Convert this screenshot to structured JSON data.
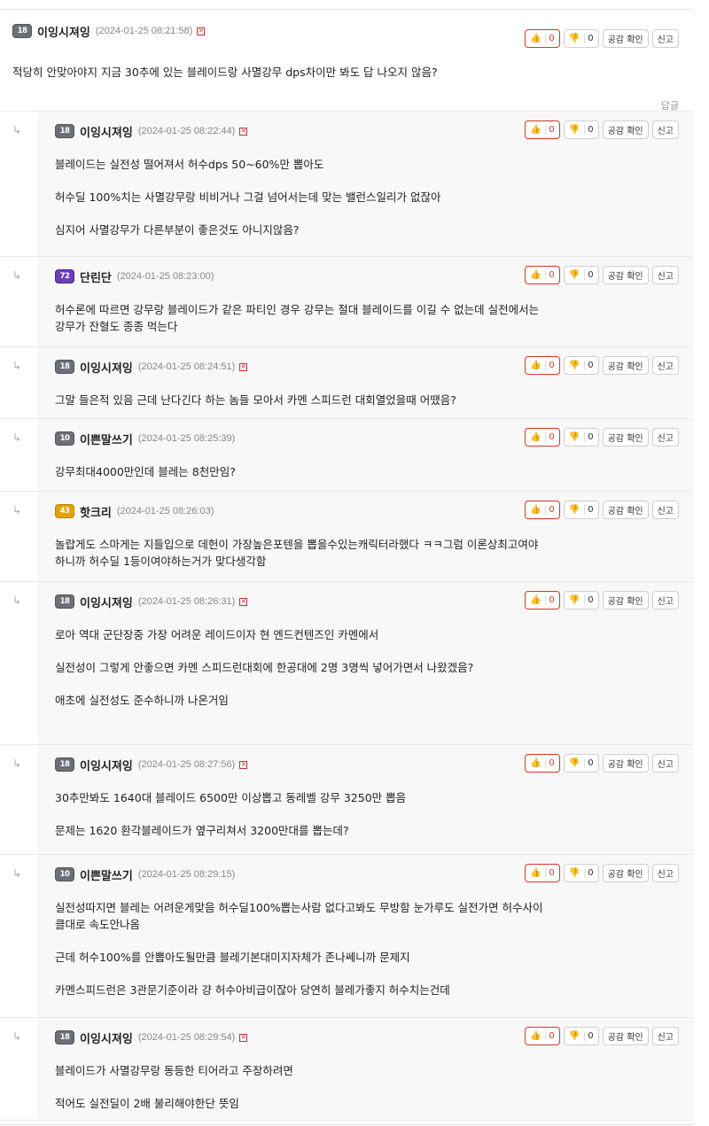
{
  "buttons": {
    "like_icon": "thumbs-up-icon",
    "dislike_icon": "thumbs-down-icon",
    "empathy_label": "공감 확인",
    "report_label": "신고"
  },
  "main_comment": {
    "badge": "18",
    "nick": "이잉시져잉",
    "date": "(2024-01-25 08:21:58)",
    "like": "0",
    "dislike": "0",
    "text": "적당히 안맞아야지 지금 30추에 있는 블레이드랑 사멸강무 dps차이만 봐도 답 나오지 않음?",
    "reply_label": "답글"
  },
  "replies": [
    {
      "badge": "18",
      "nick": "이잉시져잉",
      "date": "(2024-01-25 08:22:44)",
      "like": "0",
      "dislike": "0",
      "paragraphs": [
        "블레이드는 실전성 떨어져서 허수dps 50~60%만 뽑아도",
        "허수딜 100%치는 사멸강무랑 비비거나 그걸 넘어서는데 맞는 밸런스일리가 없잖아",
        "심지어 사멸강무가 다른부분이 좋은것도 아니지않음?"
      ]
    },
    {
      "badge": "72",
      "nick": "단린단",
      "date": "(2024-01-25 08:23:00)",
      "like": "0",
      "dislike": "0",
      "paragraphs": [
        "허수론에 따르면 강무랑 블레이드가 같은 파티인 경우 강무는 절대 블레이드를 이길 수 없는데 실전에서는 강무가 잔혈도 종종 먹는다"
      ]
    },
    {
      "badge": "18",
      "nick": "이잉시져잉",
      "date": "(2024-01-25 08:24:51)",
      "like": "0",
      "dislike": "0",
      "paragraphs": [
        "그말 들은적 있음 근데 난다긴다 하는 놈들 모아서 카멘 스피드런 대회열었을때 어땠음?"
      ]
    },
    {
      "badge": "10",
      "nick": "이쁜말쓰기",
      "date": "(2024-01-25 08:25:39)",
      "like": "0",
      "dislike": "0",
      "paragraphs": [
        "강무최대4000만인데 블레는 8천만임?"
      ]
    },
    {
      "badge": "43",
      "nick": "핫크리",
      "date": "(2024-01-25 08:26:03)",
      "like": "0",
      "dislike": "0",
      "paragraphs": [
        "놀랍게도 스마게는 지들입으로 데헌이 가장높은포텐을 뽑을수있는캐릭터라했다 ㅋㅋ그럼 이론상최고여야하니까 허수딜 1등이여야하는거가 맞다생각함"
      ]
    },
    {
      "badge": "18",
      "nick": "이잉시져잉",
      "date": "(2024-01-25 08:26:31)",
      "like": "0",
      "dislike": "0",
      "paragraphs": [
        "로아 역대 군단장중 가장 어려운 레이드이자 현 엔드컨텐즈인 카멘에서",
        "실전성이 그렇게 안좋으면 카멘 스피드런대회에 한공대에 2명 3명씩 넣어가면서 나왔겠음?",
        "애초에 실전성도 준수하니까 나온거임"
      ]
    },
    {
      "badge": "18",
      "nick": "이잉시져잉",
      "date": "(2024-01-25 08:27:56)",
      "like": "0",
      "dislike": "0",
      "paragraphs": [
        "30추만봐도 1640대 블레이드 6500만 이상뽑고 동레벨 강무 3250만 뽑음",
        "문제는 1620 환각블레이드가 옆구리쳐서 3200만대를 뽑는데?"
      ]
    },
    {
      "badge": "10",
      "nick": "이쁜말쓰기",
      "date": "(2024-01-25 08:29:15)",
      "like": "0",
      "dislike": "0",
      "paragraphs": [
        "실전성따지면 블레는 어려운게맞음 허수딜100%뽑는사람 없다고봐도 무방함 눈가루도 실전가면 허수사이클대로 속도안나옴",
        "근데 허수100%를 안뽑아도될만큼 블레기본대미지자체가 존나쎄니까 문제지",
        "카멘스피드런은 3관문기준이라 걍 허수아비급이잖아 당연히 블레가좋지 허수치는건데"
      ]
    },
    {
      "badge": "18",
      "nick": "이잉시져잉",
      "date": "(2024-01-25 08:29:54)",
      "like": "0",
      "dislike": "0",
      "paragraphs": [
        "블레이드가 사멸강무랑 동등한 티어라고 주장하려면",
        "적어도 실전딜이 2배 불리해야한단 뜻임"
      ]
    }
  ]
}
